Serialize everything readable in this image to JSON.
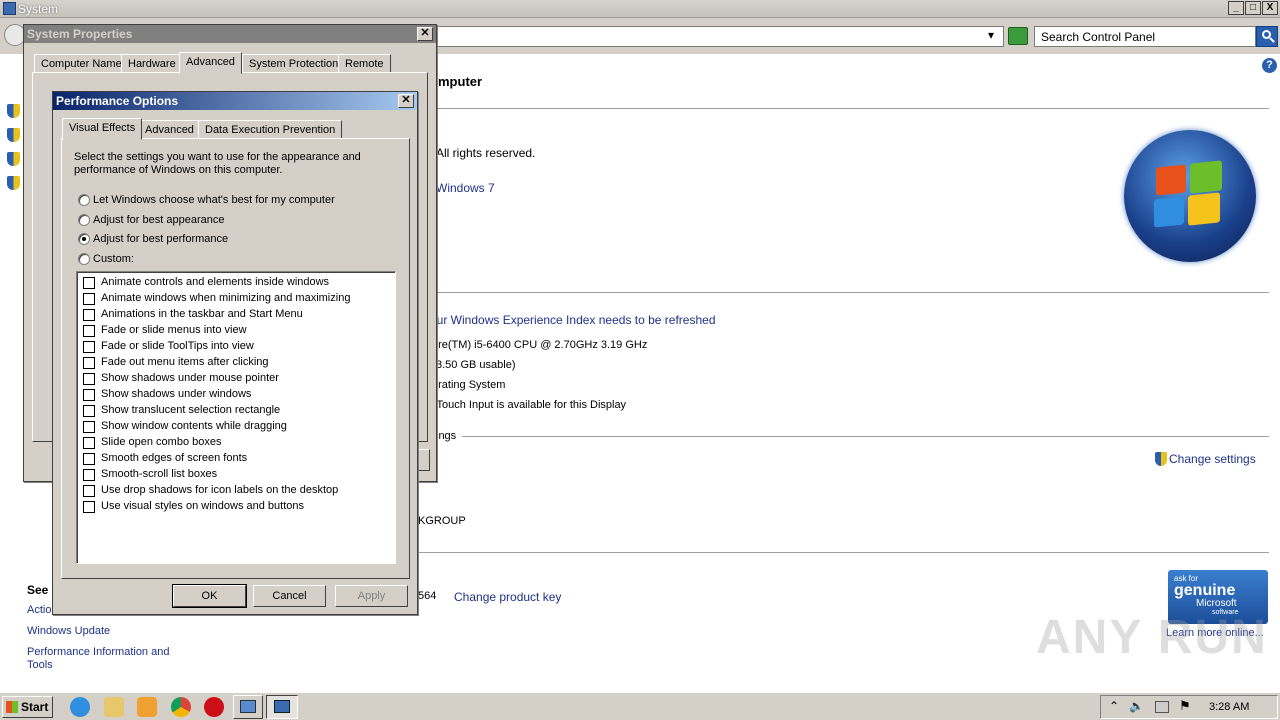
{
  "window": {
    "title": "System",
    "min": "_",
    "max": "□",
    "close": "X"
  },
  "address": {
    "search_placeholder": "Search Control Panel",
    "dropdown": "▾"
  },
  "system_page": {
    "heading_partial": "mputer",
    "rights": ".  All rights reserved.",
    "edition": "Windows 7",
    "wei_link": "our Windows Experience Index needs to be refreshed",
    "cpu": "ore(TM) i5-6400 CPU @ 2.70GHz   3.19 GHz",
    "ram": "3.50 GB usable)",
    "system_type": "erating System",
    "pen": "r Touch Input is available for this Display",
    "settings_group": "ings",
    "change_settings": "Change settings",
    "workgroup": "KGROUP",
    "product_id_tail": "564",
    "change_key": "Change product key",
    "see_also": "See",
    "action_partial": "Actio",
    "windows_update": "Windows Update",
    "perf_info": "Performance Information and Tools",
    "genuine": {
      "ask": "ask for",
      "main": "genuine",
      "brand": "Microsoft",
      "sub": "software"
    },
    "learn_more": "Learn more online...",
    "watermark": "ANY RUN"
  },
  "system_properties": {
    "title": "System Properties",
    "tabs": [
      "Computer Name",
      "Hardware",
      "Advanced",
      "System Protection",
      "Remote"
    ],
    "selected_tab": "Advanced"
  },
  "perf_options": {
    "title": "Performance Options",
    "tabs": [
      "Visual Effects",
      "Advanced",
      "Data Execution Prevention"
    ],
    "selected_tab": "Visual Effects",
    "intro": "Select the settings you want to use for the appearance and performance of Windows on this computer.",
    "radios": [
      {
        "label": "Let Windows choose what's best for my computer",
        "checked": false
      },
      {
        "label": "Adjust for best appearance",
        "checked": false
      },
      {
        "label": "Adjust for best performance",
        "checked": true
      },
      {
        "label": "Custom:",
        "checked": false
      }
    ],
    "effects": [
      "Animate controls and elements inside windows",
      "Animate windows when minimizing and maximizing",
      "Animations in the taskbar and Start Menu",
      "Fade or slide menus into view",
      "Fade or slide ToolTips into view",
      "Fade out menu items after clicking",
      "Show shadows under mouse pointer",
      "Show shadows under windows",
      "Show translucent selection rectangle",
      "Show window contents while dragging",
      "Slide open combo boxes",
      "Smooth edges of screen fonts",
      "Smooth-scroll list boxes",
      "Use drop shadows for icon labels on the desktop",
      "Use visual styles on windows and buttons"
    ],
    "ok": "OK",
    "cancel": "Cancel",
    "apply": "Apply"
  },
  "taskbar": {
    "start": "Start",
    "time": "3:28 AM"
  }
}
